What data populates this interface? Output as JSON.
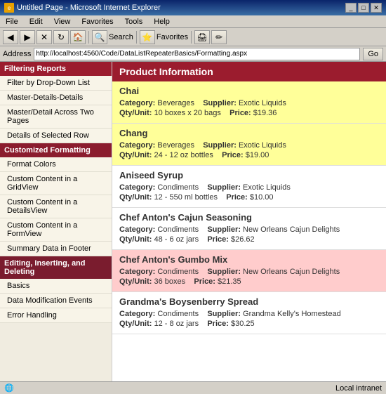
{
  "window": {
    "title": "Untitled Page - Microsoft Internet Explorer",
    "icon": "ie"
  },
  "menu": {
    "items": [
      "File",
      "Edit",
      "View",
      "Favorites",
      "Tools",
      "Help"
    ]
  },
  "toolbar": {
    "search_label": "Search",
    "favorites_label": "Favorites"
  },
  "address_bar": {
    "label": "Address",
    "url": "http://localhost:4560/Code/DataListRepeaterBasics/Formatting.aspx",
    "go_label": "Go"
  },
  "sidebar": {
    "sections": [
      {
        "label": "Filtering Reports",
        "items": [
          {
            "label": "Filter by Drop-Down List",
            "active": false
          },
          {
            "label": "Master-Details-Details",
            "active": false
          },
          {
            "label": "Master/Detail Across Two Pages",
            "active": false
          },
          {
            "label": "Details of Selected Row",
            "active": false
          }
        ]
      },
      {
        "label": "Customized Formatting",
        "items": [
          {
            "label": "Format Colors",
            "active": false
          },
          {
            "label": "Custom Content in a GridView",
            "active": false
          },
          {
            "label": "Custom Content in a DetailsView",
            "active": false
          },
          {
            "label": "Custom Content in a FormView",
            "active": false
          },
          {
            "label": "Summary Data in Footer",
            "active": false
          }
        ]
      },
      {
        "label": "Editing, Inserting, and Deleting",
        "items": [
          {
            "label": "Basics",
            "active": false
          },
          {
            "label": "Data Modification Events",
            "active": false
          },
          {
            "label": "Error Handling",
            "active": false
          }
        ]
      }
    ]
  },
  "content": {
    "header": "Product Information",
    "products": [
      {
        "name": "Chai",
        "category": "Beverages",
        "supplier": "Exotic Liquids",
        "qty_unit": "10 boxes x 20 bags",
        "price": "$19.36",
        "color": "yellow"
      },
      {
        "name": "Chang",
        "category": "Beverages",
        "supplier": "Exotic Liquids",
        "qty_unit": "24 - 12 oz bottles",
        "price": "$19.00",
        "color": "yellow"
      },
      {
        "name": "Aniseed Syrup",
        "category": "Condiments",
        "supplier": "Exotic Liquids",
        "qty_unit": "12 - 550 ml bottles",
        "price": "$10.00",
        "color": "white"
      },
      {
        "name": "Chef Anton's Cajun Seasoning",
        "category": "Condiments",
        "supplier": "New Orleans Cajun Delights",
        "qty_unit": "48 - 6 oz jars",
        "price": "$26.62",
        "color": "white"
      },
      {
        "name": "Chef Anton's Gumbo Mix",
        "category": "Condiments",
        "supplier": "New Orleans Cajun Delights",
        "qty_unit": "36 boxes",
        "price": "$21.35",
        "color": "pink"
      },
      {
        "name": "Grandma's Boysenberry Spread",
        "category": "Condiments",
        "supplier": "Grandma Kelly's Homestead",
        "qty_unit": "12 - 8 oz jars",
        "price": "$30.25",
        "color": "white"
      }
    ]
  },
  "status_bar": {
    "text": "Local intranet"
  },
  "labels": {
    "category": "Category:",
    "supplier": "Supplier:",
    "qty_unit": "Qty/Unit:",
    "price": "Price:"
  }
}
